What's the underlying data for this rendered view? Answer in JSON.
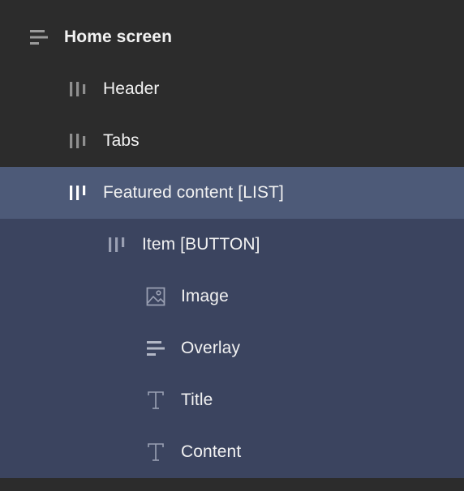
{
  "layers": {
    "root": {
      "label": "Home screen",
      "icon": "frame-icon"
    },
    "items": [
      {
        "label": "Header",
        "icon": "horizontal-layout-icon"
      },
      {
        "label": "Tabs",
        "icon": "horizontal-layout-icon"
      },
      {
        "label": "Featured content [LIST]",
        "icon": "horizontal-layout-icon"
      },
      {
        "label": "Item [BUTTON]",
        "icon": "horizontal-layout-icon"
      },
      {
        "label": "Image",
        "icon": "image-icon"
      },
      {
        "label": "Overlay",
        "icon": "frame-icon"
      },
      {
        "label": "Title",
        "icon": "text-icon"
      },
      {
        "label": "Content",
        "icon": "text-icon"
      }
    ]
  },
  "colors": {
    "panel_bg": "#2c2c2c",
    "selected_bg": "#4d5a78",
    "descendant_bg": "#3b445f",
    "text": "#f2f2f2",
    "icon_dim": "#8f8f8f"
  }
}
